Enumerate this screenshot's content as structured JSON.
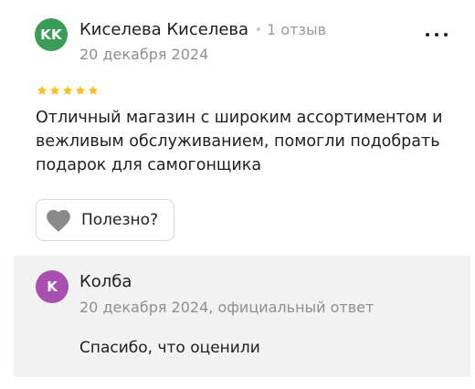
{
  "review": {
    "author": {
      "initials": "KK",
      "name": "Киселева Киселева",
      "review_count": "1 отзыв",
      "avatar_color": "#3b9c5a"
    },
    "date": "20 декабря 2024",
    "rating": 5,
    "rating_max": 5,
    "star_color": "#fcbd1f",
    "text": "Отличный магазин с широким ассортиментом и вежливым обслуживанием, помогли подобрать подарок для самогонщика",
    "helpful_label": "Полезно?",
    "helpful_icon": "heart-icon",
    "more_icon": "more-dots-icon"
  },
  "response": {
    "initials": "K",
    "name": "Колба",
    "avatar_color": "#a84fb0",
    "date": "20 декабря 2024, официальный ответ",
    "text": "Спасибо, что оценили",
    "background": "#f2f2f2"
  }
}
